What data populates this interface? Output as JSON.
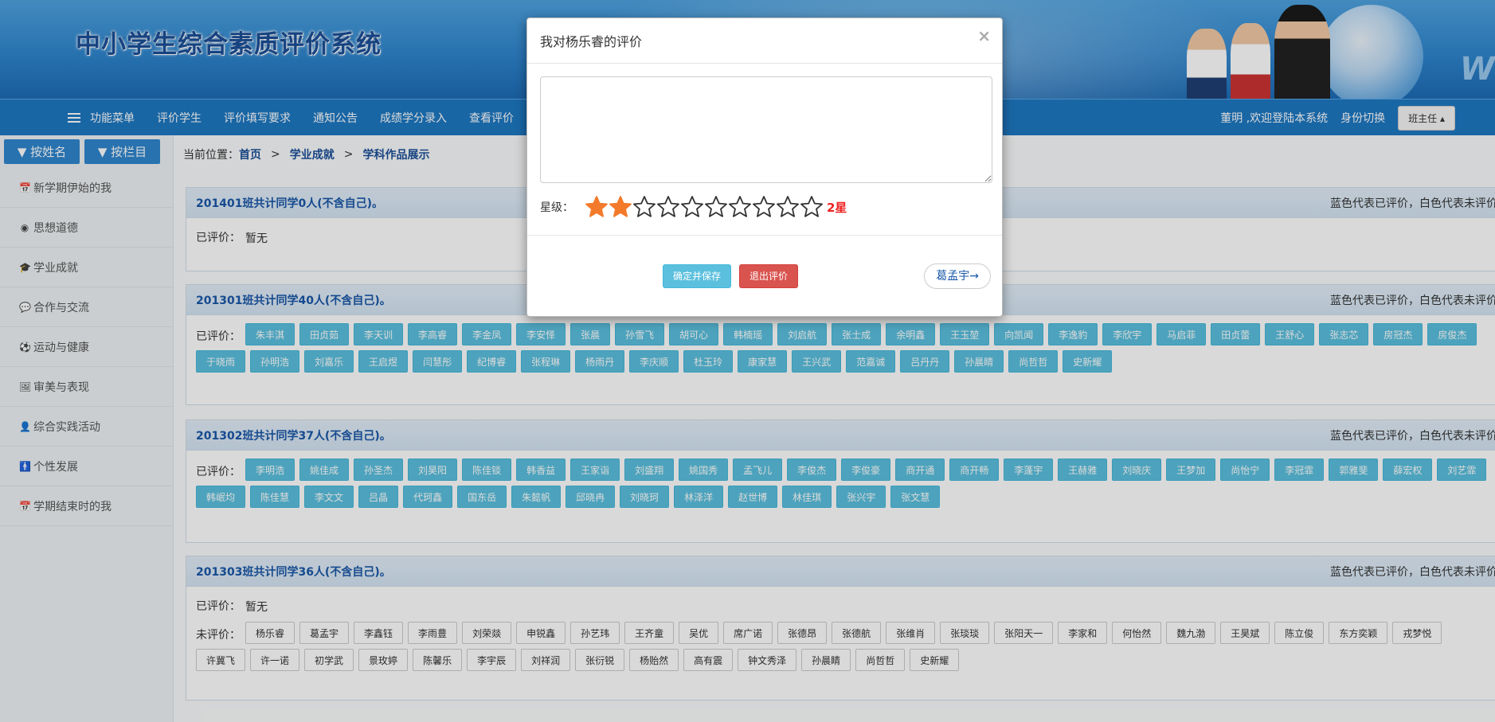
{
  "header": {
    "title": "中小学生综合素质评价系统",
    "side_text": "W"
  },
  "navbar": {
    "items": [
      "功能菜单",
      "评价学生",
      "评价填写要求",
      "通知公告",
      "成绩学分录入",
      "查看评价"
    ],
    "welcome": "董明 ,欢迎登陆本系统",
    "switch_label": "身份切换",
    "role_button": "班主任 ▴"
  },
  "sidebar": {
    "tabs": [
      "▼ 按姓名",
      "▼ 按栏目"
    ],
    "items": [
      {
        "icon": "📅",
        "label": "新学期伊始的我"
      },
      {
        "icon": "◉",
        "label": "思想道德"
      },
      {
        "icon": "🎓",
        "label": "学业成就"
      },
      {
        "icon": "💬",
        "label": "合作与交流"
      },
      {
        "icon": "⚽",
        "label": "运动与健康"
      },
      {
        "icon": "🖼",
        "label": "审美与表现"
      },
      {
        "icon": "👤",
        "label": "综合实践活动"
      },
      {
        "icon": "🚹",
        "label": "个性发展"
      },
      {
        "icon": "📅",
        "label": "学期结束时的我"
      }
    ]
  },
  "breadcrumb": {
    "prefix": "当前位置：",
    "items": [
      "首页",
      "学业成就",
      "学科作品展示"
    ],
    "sep": ">"
  },
  "panels": [
    {
      "title": "201401班共计同学0人(不含自己)。",
      "hint": "蓝色代表已评价，白色代表未评价",
      "evaluated_label": "已评价：",
      "evaluated_text": "暂无",
      "evaluated": [],
      "unevaluated_label": "",
      "unevaluated": []
    },
    {
      "title": "201301班共计同学40人(不含自己)。",
      "hint": "蓝色代表已评价，白色代表未评价",
      "evaluated_label": "已评价：",
      "evaluated_text": "",
      "evaluated": [
        "朱丰淇",
        "田贞茹",
        "李天训",
        "李高睿",
        "李金凤",
        "李安怿",
        "张晨",
        "孙雪飞",
        "胡可心",
        "韩楠瑶",
        "刘启航",
        "张士成",
        "余明鑫",
        "王玉堃",
        "向凯闻",
        "李逸豹",
        "李欣宇",
        "马启菲",
        "田贞蕾",
        "王舒心",
        "张志芯",
        "房冠杰",
        "房俊杰",
        "于晓雨",
        "孙明浩",
        "刘嘉乐",
        "王启煜",
        "闫慧彤",
        "纪博睿",
        "张程琳",
        "杨雨丹",
        "李庆顺",
        "杜玉玲",
        "康家慧",
        "王兴武",
        "范嘉诚",
        "吕丹丹",
        "孙晨睛",
        "尚哲哲",
        "史新耀"
      ],
      "unevaluated_label": "",
      "unevaluated": []
    },
    {
      "title": "201302班共计同学37人(不含自己)。",
      "hint": "蓝色代表已评价，白色代表未评价",
      "evaluated_label": "已评价：",
      "evaluated_text": "",
      "evaluated": [
        "李明浩",
        "姚佳成",
        "孙圣杰",
        "刘昊阳",
        "陈佳锬",
        "韩香益",
        "王家诣",
        "刘盛翔",
        "姚国秀",
        "孟飞儿",
        "李俊杰",
        "李俊豪",
        "商开通",
        "商开畅",
        "李蓬宇",
        "王赫雅",
        "刘晓庆",
        "王梦加",
        "尚怡宁",
        "李冠霏",
        "郭雅斐",
        "薛宏权",
        "刘艺霏",
        "韩岷均",
        "陈佳慧",
        "李文文",
        "吕晶",
        "代珂鑫",
        "国东岳",
        "朱懿帆",
        "邱晓冉",
        "刘晓珂",
        "林泽洋",
        "赵世博",
        "林佳琪",
        "张兴宇",
        "张文慧"
      ],
      "unevaluated_label": "",
      "unevaluated": []
    },
    {
      "title": "201303班共计同学36人(不含自己)。",
      "hint": "蓝色代表已评价，白色代表未评价",
      "evaluated_label": "已评价：",
      "evaluated_text": "暂无",
      "evaluated": [],
      "unevaluated_label": "未评价：",
      "unevaluated": [
        "杨乐睿",
        "葛孟宇",
        "李鑫钰",
        "李雨豊",
        "刘荣燚",
        "申锐鑫",
        "孙艺玮",
        "王齐童",
        "吴优",
        "席广诺",
        "张德昂",
        "张德航",
        "张维肖",
        "张琰琰",
        "张阳天一",
        "李家和",
        "何怡然",
        "魏九渤",
        "王昊斌",
        "陈立俊",
        "东方奕颖",
        "戎梦悦",
        "许冀飞",
        "许一诺",
        "初学武",
        "景玫婷",
        "陈馨乐",
        "李宇辰",
        "刘祥润",
        "张衍锐",
        "杨贻然",
        "高有震",
        "钟文秀泽",
        "孙晨睛",
        "尚哲哲",
        "史新耀"
      ]
    }
  ],
  "modal": {
    "title": "我对杨乐睿的评价",
    "close": "×",
    "textarea_value": "",
    "stars_label": "星级：",
    "stars_filled": 2,
    "stars_total": 10,
    "star_count_text": "2星",
    "save_button": "确定并保存",
    "exit_button": "退出评价",
    "next_button": "葛孟宇→",
    "colors": {
      "star_filled": "#f47a2b",
      "star_empty": "#333333"
    }
  }
}
